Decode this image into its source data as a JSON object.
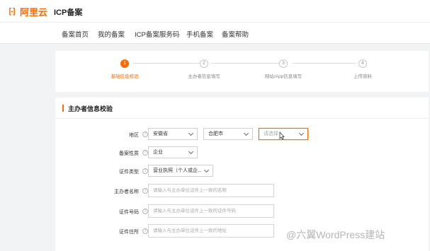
{
  "brand": {
    "logo_mark": "[-]",
    "logo_text": "阿里云",
    "product": "ICP备案"
  },
  "nav": {
    "items": [
      "备案首页",
      "我的备案",
      "ICP备案服务码",
      "手机备案",
      "备案帮助"
    ]
  },
  "steps": [
    {
      "num": "1",
      "label": "基础信息校验",
      "state": "active"
    },
    {
      "num": "2",
      "label": "主办者信息填写",
      "state": "todo"
    },
    {
      "num": "3",
      "label": "网站/App信息填写",
      "state": "todo"
    },
    {
      "num": "4",
      "label": "上传资料",
      "state": "todo"
    }
  ],
  "section": {
    "title": "主办者信息校验"
  },
  "form": {
    "region_label": "地区",
    "province": "安徽省",
    "city": "合肥市",
    "district_placeholder": "请选择",
    "nature_label": "备案性质",
    "nature_value": "企业",
    "cert_type_label": "证件类型",
    "cert_type_value": "营业执照（个人或企...",
    "host_name_label": "主办者名称",
    "host_name_placeholder": "请输入与主办单位证件上一致的名称",
    "cert_no_label": "证件号码",
    "cert_no_placeholder": "请输入与主办单位证件上一致的证件号码",
    "cert_addr_label": "证件住所",
    "cert_addr_placeholder": "请输入与主办单位证件上一致的地址"
  },
  "watermark": "@六翼WordPress建站",
  "colors": {
    "accent": "#ff6a00",
    "bg": "#f2f3f5"
  }
}
